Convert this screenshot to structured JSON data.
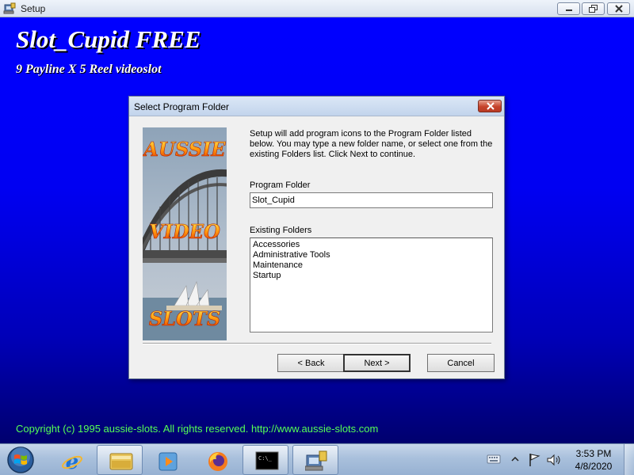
{
  "window": {
    "title": "Setup"
  },
  "banner": {
    "product_title": "Slot_Cupid FREE",
    "subtitle": "9 Payline X 5 Reel videoslot",
    "copyright": "Copyright (c) 1995 aussie-slots. All rights reserved. http://www.aussie-slots.com"
  },
  "dialog": {
    "title": "Select Program Folder",
    "instructions": "Setup will add program icons to the Program Folder listed below. You may type a new folder name, or select one from the existing Folders list. Click Next to continue.",
    "program_folder_label": "Program Folder",
    "program_folder_value": "Slot_Cupid",
    "existing_folders_label": "Existing Folders",
    "existing_folders": [
      "Accessories",
      "Administrative Tools",
      "Maintenance",
      "Startup"
    ],
    "buttons": {
      "back": "< Back",
      "next": "Next >",
      "cancel": "Cancel"
    }
  },
  "side_image": {
    "words": [
      "AUSSIE",
      "VIDEO",
      "SLOTS"
    ]
  },
  "taskbar": {
    "pinned": [
      "internet-explorer-icon",
      "file-explorer-icon",
      "media-player-icon",
      "firefox-icon",
      "command-prompt-icon",
      "setup-icon"
    ],
    "clock_time": "3:53 PM",
    "clock_date": "4/8/2020"
  },
  "colors": {
    "background_top": "#0000ff",
    "background_bottom": "#00006e",
    "copyright_text": "#55ff55"
  }
}
